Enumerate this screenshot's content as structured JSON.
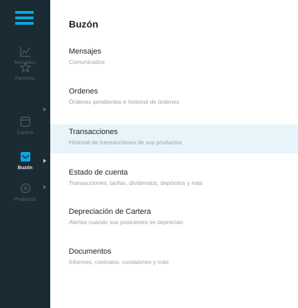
{
  "sidebar": {
    "items": [
      {
        "label": "Mercados",
        "icon": "chart-line-icon",
        "active": false
      },
      {
        "label": "Favoritos",
        "icon": "star-icon",
        "active": false
      },
      {
        "label": "Cartera",
        "icon": "portfolio-icon",
        "active": false
      },
      {
        "label": "Buzón",
        "icon": "inbox-icon",
        "active": true
      },
      {
        "label": "Productos",
        "icon": "products-icon",
        "active": false
      }
    ]
  },
  "main": {
    "title": "Buzón",
    "items": [
      {
        "title": "Mensajes",
        "description": "Comunicados"
      },
      {
        "title": "Ordenes",
        "description": "Órdenes pendientes e historial de órdenes"
      },
      {
        "title": "Transacciones",
        "description": "Historial de transacciones de sus productos"
      },
      {
        "title": "Estado de cuenta",
        "description": "Transacciones, tarifas, dividendos, depósitos y más"
      },
      {
        "title": "Depreciación de Cartera",
        "description": "Alertas cuando sus posiciones se deprecian"
      },
      {
        "title": "Documentos",
        "description": "Informes, contratos, comisiones y más"
      }
    ]
  },
  "colors": {
    "sidebar_bg": "#1b2b33",
    "accent": "#0aa6e0",
    "highlight_bg": "#e7f4fa"
  }
}
